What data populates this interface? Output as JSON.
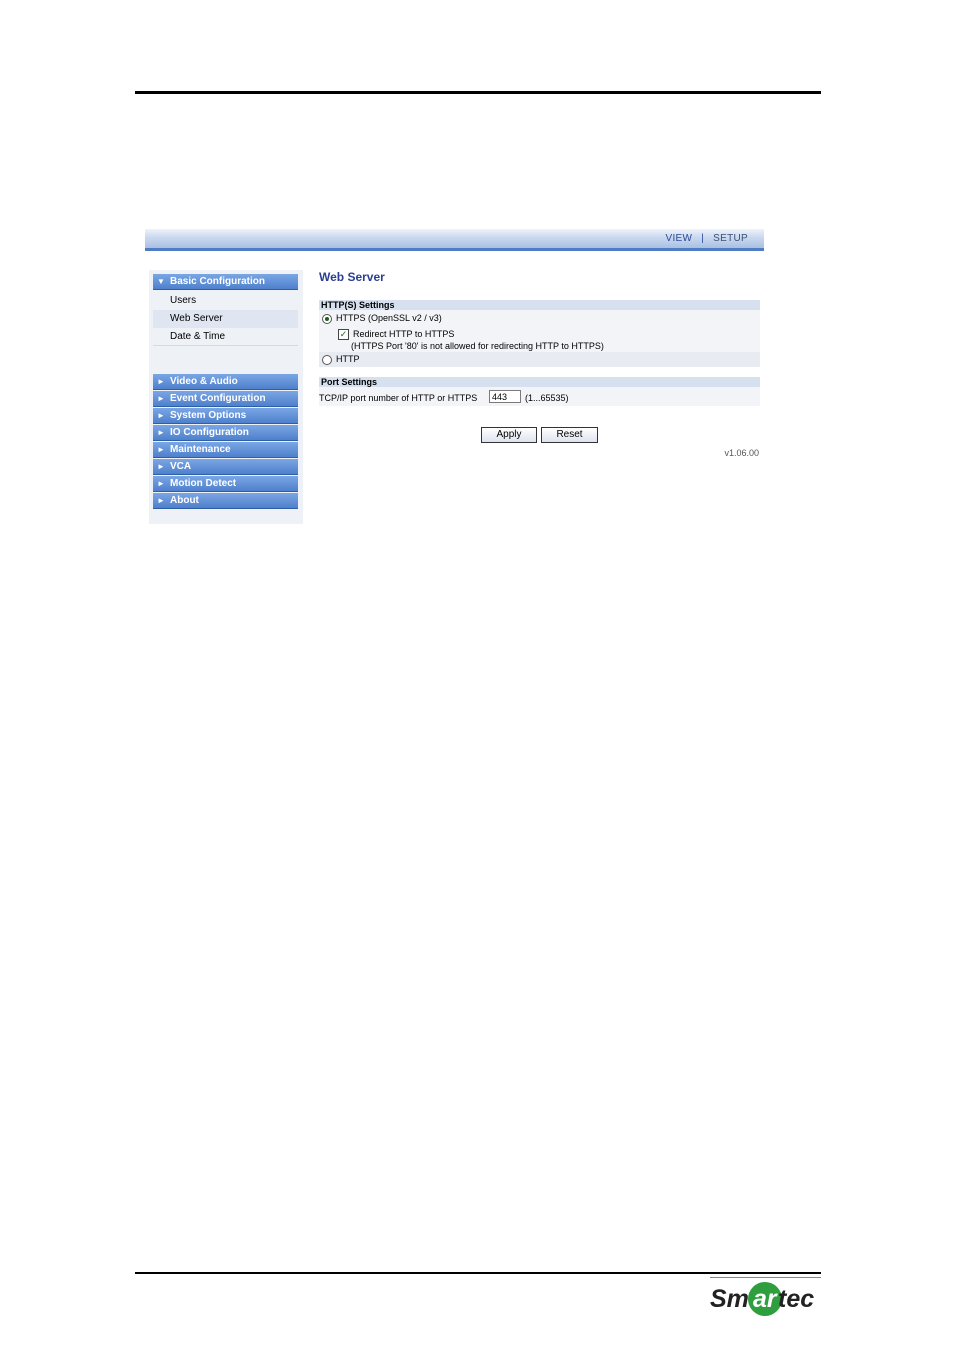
{
  "header": {
    "view_label": "VIEW",
    "separator": "|",
    "setup_label": "SETUP"
  },
  "sidebar": {
    "basic_config": {
      "label": "Basic Configuration",
      "items": [
        "Users",
        "Web Server",
        "Date & Time"
      ]
    },
    "menus": [
      "Video & Audio",
      "Event Configuration",
      "System Options",
      "IO Configuration",
      "Maintenance",
      "VCA",
      "Motion Detect",
      "About"
    ]
  },
  "main": {
    "title": "Web Server",
    "https_section": {
      "heading": "HTTP(S) Settings",
      "https_option": "HTTPS (OpenSSL v2 / v3)",
      "https_selected": true,
      "redirect_label": "Redirect HTTP to HTTPS",
      "redirect_checked": true,
      "redirect_note": "(HTTPS Port '80' is not allowed for redirecting HTTP to HTTPS)",
      "http_option": "HTTP"
    },
    "port_section": {
      "heading": "Port Settings",
      "port_label": "TCP/IP port number of HTTP or HTTPS",
      "port_value": "443",
      "port_range": "(1...65535)"
    },
    "apply_label": "Apply",
    "reset_label": "Reset",
    "version": "v1.06.00"
  },
  "logo": {
    "text": "Smartec",
    "accent_color": "#2e9e3e"
  }
}
